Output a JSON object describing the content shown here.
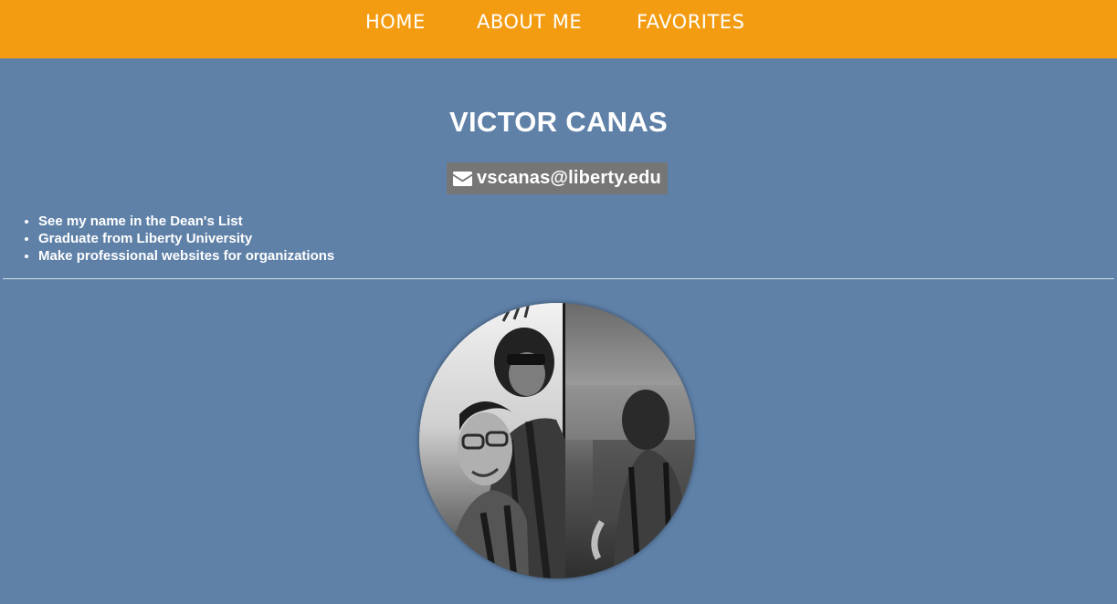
{
  "nav": {
    "items": [
      {
        "label": "HOME"
      },
      {
        "label": "ABOUT ME"
      },
      {
        "label": "FAVORITES"
      }
    ]
  },
  "profile": {
    "name": "VICTOR CANAS",
    "email": "vscanas@liberty.edu",
    "email_icon": "envelope-icon",
    "goals": [
      "See my name in the Dean's List",
      "Graduate from Liberty University",
      "Make professional websites for organizations"
    ]
  },
  "colors": {
    "nav_bg": "#f39c12",
    "page_bg": "#5f81a8",
    "badge_bg": "#767676",
    "text": "#ffffff"
  }
}
